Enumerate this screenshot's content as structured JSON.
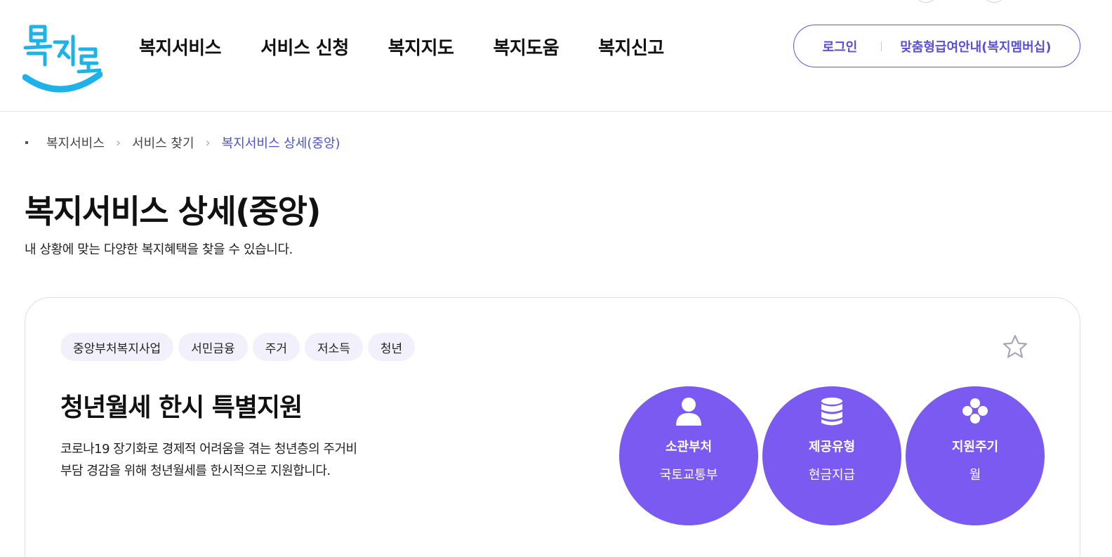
{
  "header": {
    "logo_text": "복지로",
    "nav": [
      "복지서비스",
      "서비스 신청",
      "복지지도",
      "복지도움",
      "복지신고"
    ],
    "login_label": "로그인",
    "membership_label": "맞춤형급여안내(복지멤버십)"
  },
  "breadcrumb": {
    "items": [
      "복지서비스",
      "서비스 찾기"
    ],
    "current": "복지서비스 상세(중앙)"
  },
  "page": {
    "title": "복지서비스 상세(중앙)",
    "description": "내 상황에 맞는 다양한 복지혜택을 찾을 수 있습니다."
  },
  "service": {
    "tags": [
      "중앙부처복지사업",
      "서민금융",
      "주거",
      "저소득",
      "청년"
    ],
    "title": "청년월세 한시 특별지원",
    "description_lines": [
      "코로나19 장기화로 경제적 어려움을 겪는 청년층의 주거비",
      "부담 경감을 위해 청년월세를 한시적으로 지원합니다."
    ],
    "info": [
      {
        "label": "소관부처",
        "value": "국토교통부",
        "icon": "person-icon"
      },
      {
        "label": "제공유형",
        "value": "현금지급",
        "icon": "database-icon"
      },
      {
        "label": "지원주기",
        "value": "월",
        "icon": "dots-icon"
      }
    ]
  },
  "colors": {
    "accent": "#7a5af0",
    "link": "#5a4fd9",
    "tag_bg": "#f1f0fb",
    "logo_blue": "#1fb2e8"
  }
}
